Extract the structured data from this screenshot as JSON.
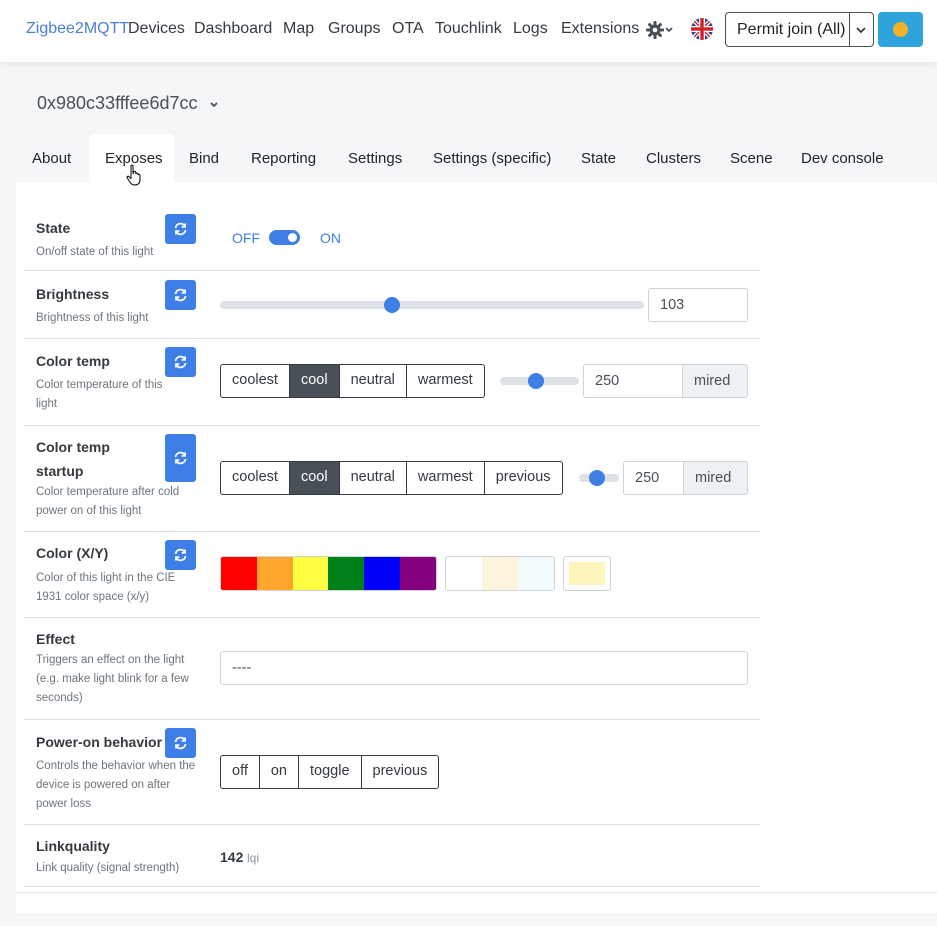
{
  "navbar": {
    "brand": "Zigbee2MQTT",
    "links": [
      "Devices",
      "Dashboard",
      "Map",
      "Groups",
      "OTA",
      "Touchlink",
      "Logs",
      "Extensions"
    ],
    "permit_join_label": "Permit join (All)"
  },
  "device": {
    "title": "0x980c33fffee6d7cc"
  },
  "tabs": [
    "About",
    "Exposes",
    "Bind",
    "Reporting",
    "Settings",
    "Settings (specific)",
    "State",
    "Clusters",
    "Scene",
    "Dev console"
  ],
  "active_tab": "Exposes",
  "exposes": {
    "state": {
      "title": "State",
      "desc": "On/off state of this light",
      "off_label": "OFF",
      "on_label": "ON",
      "value": "ON"
    },
    "brightness": {
      "title": "Brightness",
      "desc": "Brightness of this light",
      "value": "103",
      "slider_fraction": 0.405
    },
    "color_temp": {
      "title": "Color temp",
      "desc": "Color temperature of this light",
      "presets": [
        "coolest",
        "cool",
        "neutral",
        "warmest"
      ],
      "selected": "cool",
      "value": "250",
      "unit": "mired",
      "slider_fraction": 0.46
    },
    "color_temp_startup": {
      "title": "Color temp startup",
      "desc": "Color temperature after cold power on of this light",
      "presets": [
        "coolest",
        "cool",
        "neutral",
        "warmest",
        "previous"
      ],
      "selected": "cool",
      "value": "250",
      "unit": "mired",
      "slider_fraction": 0.46
    },
    "color_xy": {
      "title": "Color (X/Y)",
      "desc": "Color of this light in the CIE 1931 color space (x/y)",
      "palette": [
        "#ff0000",
        "#ffa52c",
        "#ffff41",
        "#008018",
        "#0000f9",
        "#86007d"
      ],
      "whites": [
        "#ffffff",
        "#fdf4dc",
        "#f4fbff"
      ],
      "current_color": "#fef5bd"
    },
    "effect": {
      "title": "Effect",
      "desc": "Triggers an effect on the light (e.g. make light blink for a few seconds)",
      "value": "----"
    },
    "power_on_behavior": {
      "title": "Power-on behavior",
      "desc": "Controls the behavior when the device is powered on after power loss",
      "options": [
        "off",
        "on",
        "toggle",
        "previous"
      ]
    },
    "linkquality": {
      "title": "Linkquality",
      "desc": "Link quality (signal strength)",
      "value": "142",
      "unit": "lqi"
    }
  },
  "colors": {
    "accent": "#3d7fe6",
    "brand": "#4a7fd6",
    "permit_button_border": "#495057",
    "avatar_button": "#2ea3dc"
  }
}
